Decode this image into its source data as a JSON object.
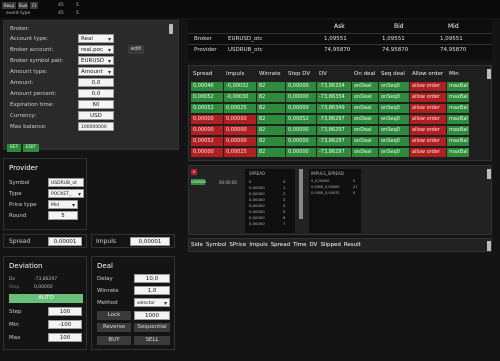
{
  "topbar": {
    "tags": [
      "Ввод",
      "Выв",
      "Ct"
    ],
    "c1": "45",
    "c2": "5",
    "row2_label": "event type",
    "row2_n1": "45",
    "row2_n2": "5"
  },
  "broker": {
    "section_title": "Broker:",
    "fields": [
      {
        "label": "Account type:",
        "value": "Real"
      },
      {
        "label": "Broker account:",
        "value": "real.poc"
      },
      {
        "label": "Broker symbol pair:",
        "value": "EURUSD"
      },
      {
        "label": "Amount type:",
        "value": "Amount"
      },
      {
        "label": "Amount:",
        "value": "0,0"
      },
      {
        "label": "Amount percent:",
        "value": "0,0"
      },
      {
        "label": "Expiration time:",
        "value": "60"
      },
      {
        "label": "Currency:",
        "value": "USD"
      },
      {
        "label": "Max balance:",
        "value": "100000000"
      }
    ],
    "edit_label": "edit",
    "set_label": "SET",
    "edit2_label": "EDIT"
  },
  "quotes": {
    "headers": [
      "Ask",
      "Bid",
      "Mid"
    ],
    "rows": [
      {
        "name": "Broker",
        "symbol": "EURUSD_otc",
        "ask": "1,09551",
        "bid": "1,09551",
        "mid": "1,09551"
      },
      {
        "name": "Provider",
        "symbol": "USDRUB_otc",
        "ask": "74,95870",
        "bid": "74,95870",
        "mid": "74,95870"
      }
    ]
  },
  "signals": {
    "headers": [
      "Spread",
      "Impuls",
      "Winrate",
      "Step DV",
      "DV",
      "On deal",
      "Seq deal",
      "Allow order",
      "Min"
    ],
    "rows": [
      {
        "spread": "0,00046",
        "impuls": "-0,00032",
        "winrate": "82",
        "step": "0,00000",
        "dv": "-73,86334",
        "ondeal": "onDeal",
        "seq": "onSeq0",
        "allow": "allow order",
        "min": "maxBal",
        "color": "green"
      },
      {
        "spread": "0,00052",
        "impuls": "-0,00030",
        "winrate": "82",
        "step": "0,00000",
        "dv": "-73,86334",
        "ondeal": "onDeal",
        "seq": "onSeq0",
        "allow": "allow order",
        "min": "maxBal",
        "color": "green"
      },
      {
        "spread": "0,00052",
        "impuls": "0,00025",
        "winrate": "82",
        "step": "0,00000",
        "dv": "-73,86349",
        "ondeal": "onDeal",
        "seq": "onSeq0",
        "allow": "allow order",
        "min": "maxBal",
        "color": "green"
      },
      {
        "spread": "0,00000",
        "impuls": "0,00000",
        "winrate": "82",
        "step": "0,00052",
        "dv": "-73,86297",
        "ondeal": "onDeal",
        "seq": "onSeq0",
        "allow": "allow order",
        "min": "maxBal",
        "color": "red"
      },
      {
        "spread": "0,00000",
        "impuls": "0,00000",
        "winrate": "82",
        "step": "0,00000",
        "dv": "-73,86297",
        "ondeal": "onDeal",
        "seq": "onSeq0",
        "allow": "allow order",
        "min": "maxBal",
        "color": "red"
      },
      {
        "spread": "0,00052",
        "impuls": "0,00000",
        "winrate": "82",
        "step": "0,00000",
        "dv": "-73,86297",
        "ondeal": "onDeal",
        "seq": "onSeq0",
        "allow": "allow order",
        "min": "maxBal",
        "color": "red"
      },
      {
        "spread": "0,00000",
        "impuls": "0,00025",
        "winrate": "82",
        "step": "0,00000",
        "dv": "-73,86297",
        "ondeal": "onDeal",
        "seq": "onSeq0",
        "allow": "allow order",
        "min": "maxBal",
        "color": "red"
      }
    ]
  },
  "mini": {
    "flag_label": "x",
    "chart_label": "USDRUB",
    "num": "00:00:00",
    "spread_title": "SPREAD",
    "spread_vals": [
      "0",
      "0,00000",
      "0,00000",
      "0,00000",
      "0,00000",
      "0,00000",
      "0,00000",
      "0,00000"
    ],
    "spread_idx": [
      "0",
      "1",
      "2",
      "3",
      "4",
      "5",
      "6",
      "7"
    ],
    "impuls_title": "IMPULS_SPREAD",
    "impuls_vals": [
      "0_0,00000",
      "0,0000_0,00000",
      "0,0000_0,00032"
    ],
    "impuls_nums": [
      "0",
      "21",
      "0"
    ]
  },
  "provider": {
    "title": "Provider",
    "fields": [
      {
        "label": "Symbol",
        "value": "USDRUB_ot"
      },
      {
        "label": "Type",
        "value": "POCKET_"
      },
      {
        "label": "Price type",
        "value": "Mid"
      },
      {
        "label": "Round",
        "value": "5"
      }
    ]
  },
  "spread": {
    "label": "Spread",
    "value": "0,00001"
  },
  "impuls": {
    "label": "Impuls",
    "value": "0,00001"
  },
  "deviation": {
    "title": "Deviation",
    "dv_label": "Dv",
    "dv_value": "-73,86297",
    "step_label": "Step",
    "step_value": "0,00000",
    "auto_label": "AUTO",
    "fields": [
      {
        "label": "Step",
        "value": "100"
      },
      {
        "label": "Min",
        "value": "-100"
      },
      {
        "label": "Max",
        "value": "100"
      }
    ]
  },
  "deal": {
    "title": "Deal",
    "fields": [
      {
        "label": "Delay",
        "value": "10,0"
      },
      {
        "label": "Winrate",
        "value": "1,0"
      },
      {
        "label": "Method",
        "value": "selector"
      }
    ],
    "lock_label": "Lock",
    "lock_value": "1000",
    "reverse_label": "Reverse",
    "sequential_label": "Sequential",
    "buy_label": "BUY",
    "sell_label": "SELL"
  },
  "history": {
    "headers": [
      "Side",
      "Symbol",
      "SPrice",
      "Impuls",
      "Spread",
      "Time",
      "DV",
      "Slipped",
      "Result"
    ]
  }
}
